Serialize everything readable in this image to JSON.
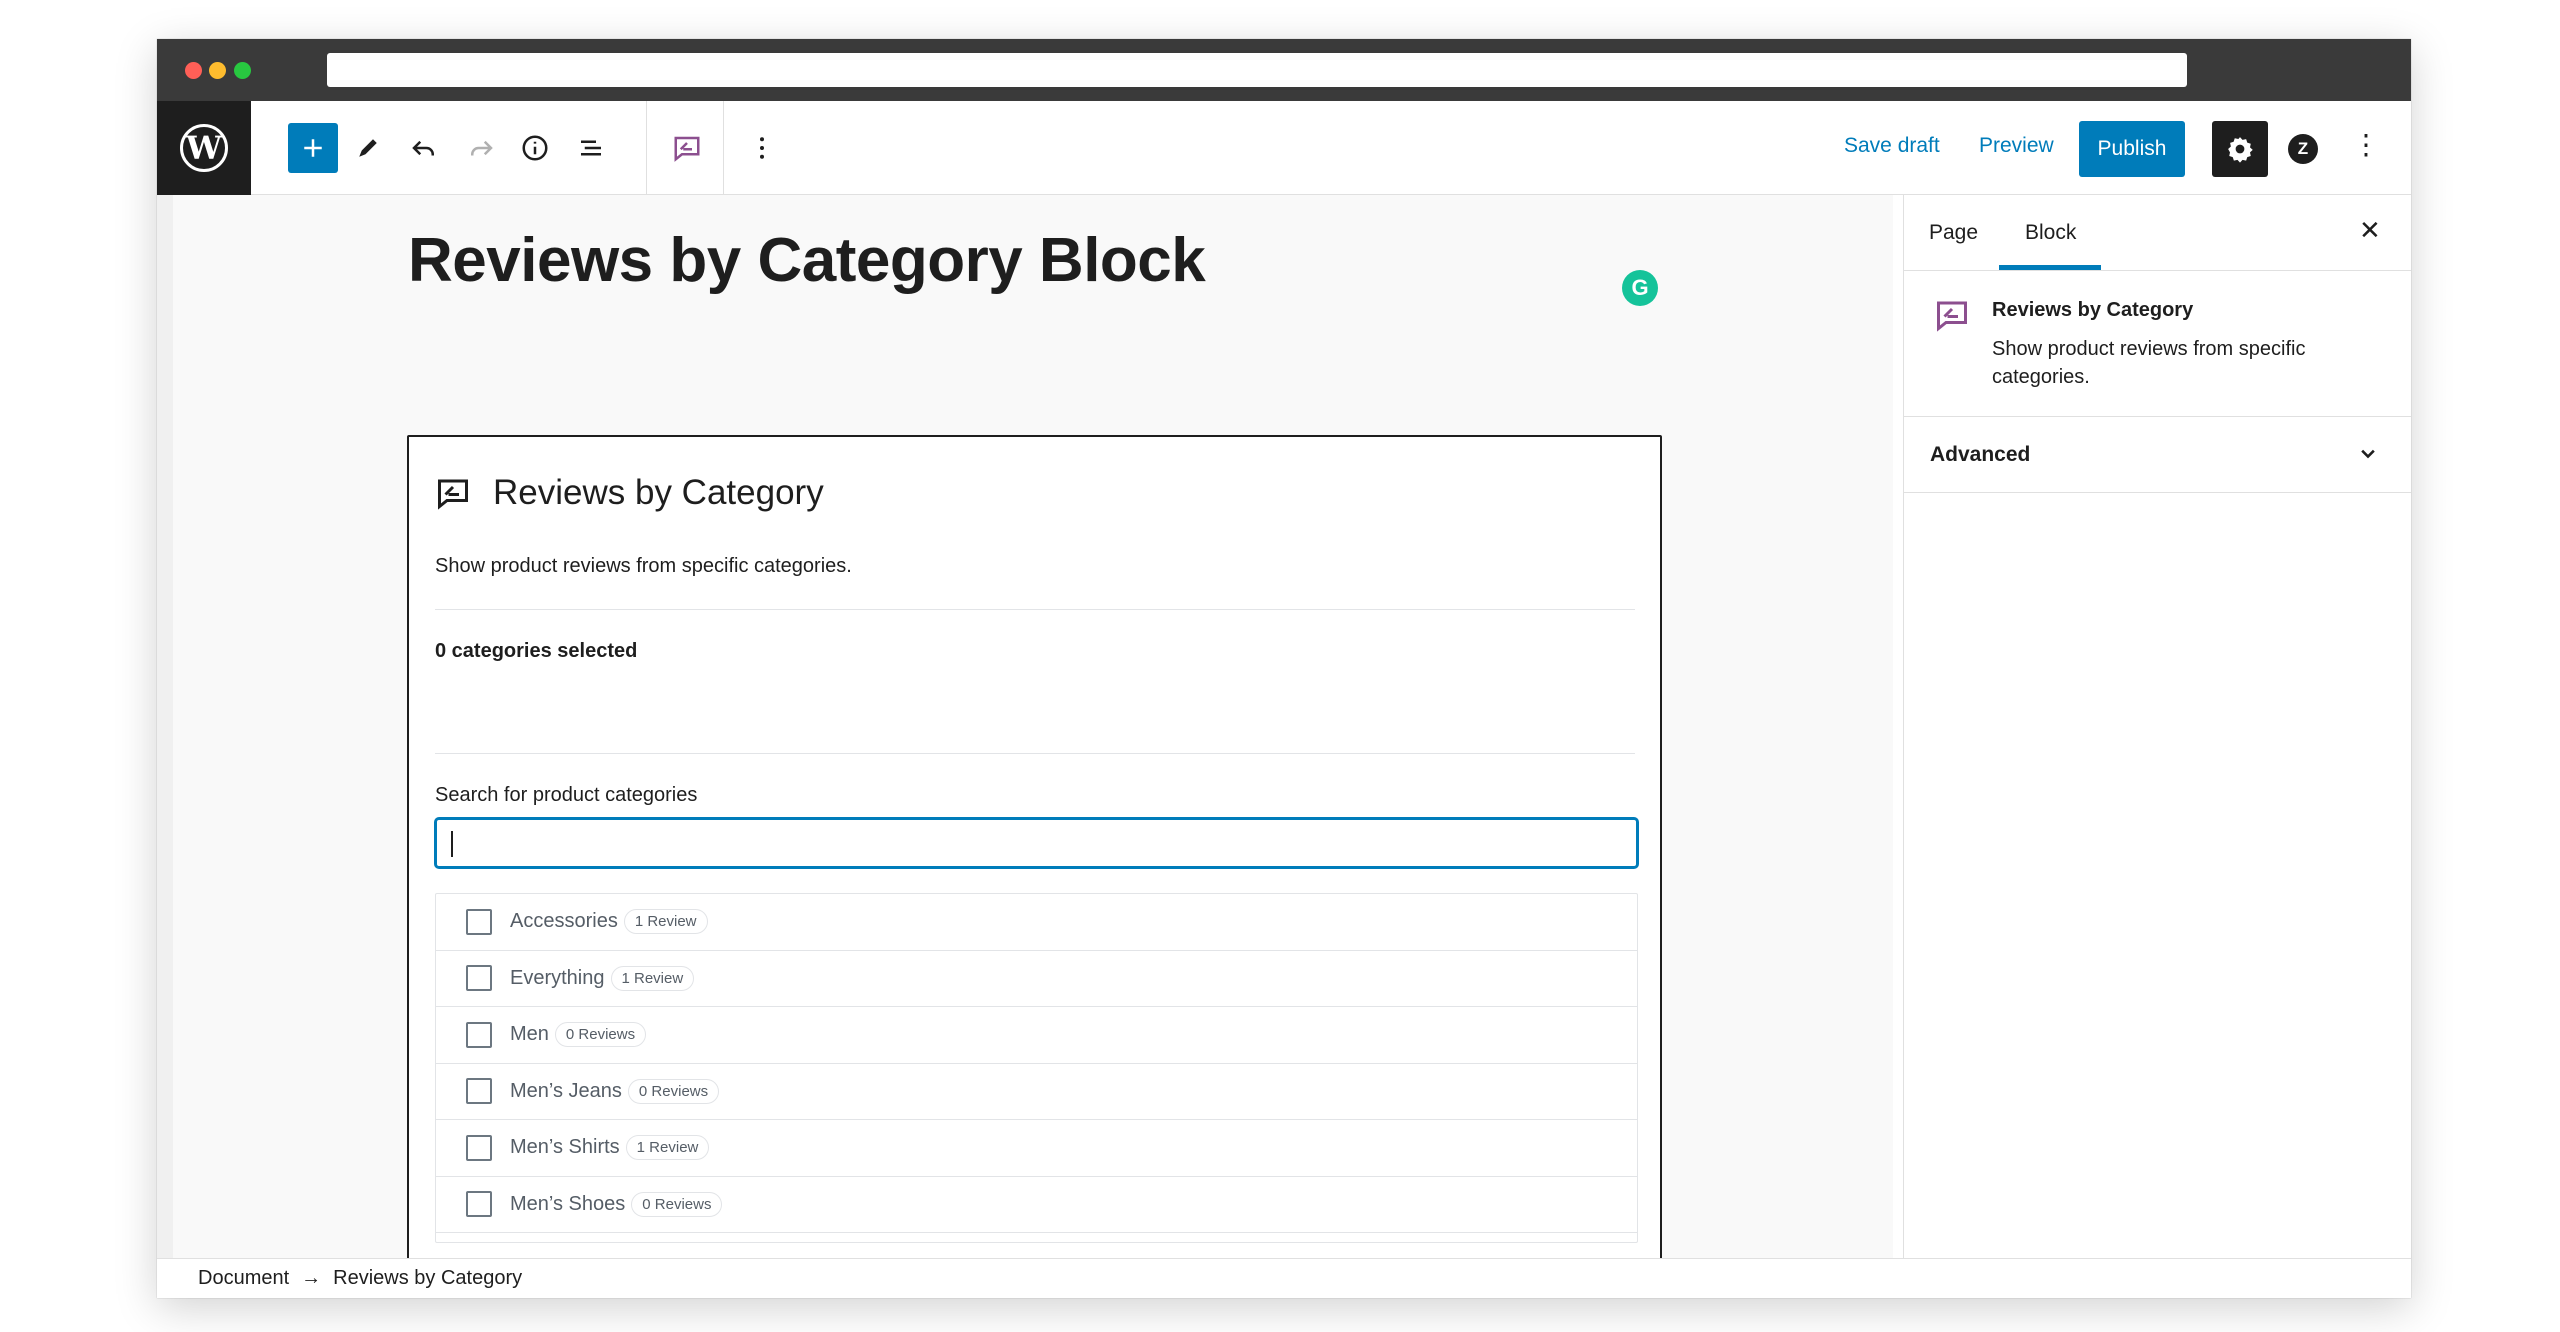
{
  "toolbar": {
    "save_draft": "Save draft",
    "preview": "Preview",
    "publish": "Publish"
  },
  "editor": {
    "post_title": "Reviews by Category Block"
  },
  "block": {
    "title": "Reviews by Category",
    "description": "Show product reviews from specific categories.",
    "selected_count": "0 categories selected",
    "search_label": "Search for product categories",
    "search_value": "",
    "categories": [
      {
        "name": "Accessories",
        "count": "1 Review"
      },
      {
        "name": "Everything",
        "count": "1 Review"
      },
      {
        "name": "Men",
        "count": "0 Reviews"
      },
      {
        "name": "Men’s Jeans",
        "count": "0 Reviews"
      },
      {
        "name": "Men’s Shirts",
        "count": "1 Review"
      },
      {
        "name": "Men’s Shoes",
        "count": "0 Reviews"
      }
    ]
  },
  "sidebar": {
    "tabs": [
      {
        "label": "Page"
      },
      {
        "label": "Block"
      }
    ],
    "active_tab": "Block",
    "block_card": {
      "title": "Reviews by Category",
      "description": "Show product reviews from specific categories."
    },
    "advanced_label": "Advanced"
  },
  "breadcrumb": {
    "root": "Document",
    "current": "Reviews by Category"
  },
  "colors": {
    "accent": "#007cba",
    "dark": "#1e1e1e",
    "block_icon": "#8c4f8f",
    "grammarly": "#15c39a"
  }
}
